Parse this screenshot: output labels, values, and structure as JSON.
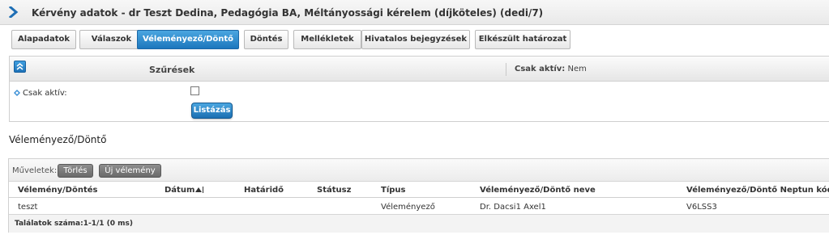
{
  "header": {
    "title": "Kérvény adatok - dr Teszt Dedina, Pedagógia BA, Méltányossági kérelem (díjköteles) (dedi/7)"
  },
  "tabs": [
    {
      "label": "Alapadatok"
    },
    {
      "label": "Válaszok"
    },
    {
      "label": "Véleményező/Döntő",
      "active": true
    },
    {
      "label": "Döntés"
    },
    {
      "label": "Mellékletek"
    },
    {
      "label": "Hivatalos bejegyzések"
    },
    {
      "label": "Elkészült határozat"
    }
  ],
  "filter": {
    "title": "Szűrések",
    "status_label": "Csak aktív:",
    "status_value": "Nem",
    "field_label": "Csak aktív:",
    "checked": false,
    "list_button": "Listázás"
  },
  "section": {
    "title": "Véleményező/Döntő"
  },
  "grid": {
    "ops_label": "Műveletek:",
    "delete_button": "Törlés",
    "new_button": "Új vélemény",
    "columns": [
      "Vélemény/Döntés",
      "Dátum",
      "Határidő",
      "Státusz",
      "Típus",
      "Véleményező/Döntő neve",
      "Véleményező/Döntő Neptun kódja"
    ],
    "rows": [
      [
        "teszt",
        "",
        "",
        "",
        "Véleményező",
        "Dr. Dacsi1 Axel1",
        "V6LSS3"
      ]
    ],
    "footer": "Találatok száma:1-1/1 (0 ms)"
  },
  "colors": {
    "accent": "#1c77bd",
    "title_chevron": "#1f6fb5",
    "button_gray": "#6f6f6f"
  },
  "icons": [
    "chevron-right-icon",
    "collapse-up-icon",
    "diamond-bullet-icon",
    "sort-asc-icon"
  ]
}
